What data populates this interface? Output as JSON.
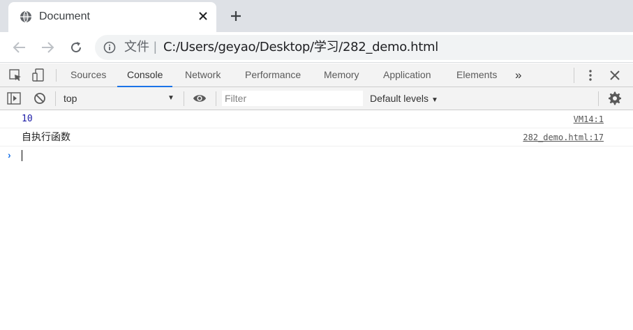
{
  "browser": {
    "tab_title": "Document",
    "new_tab_symbol": "+",
    "close_symbol": "✕",
    "address": {
      "scheme_label": "文件",
      "separator": "|",
      "url": "C:/Users/geyao/Desktop/学习/282_demo.html"
    }
  },
  "devtools": {
    "tabs": [
      {
        "label": "Sources"
      },
      {
        "label": "Console",
        "active": true
      },
      {
        "label": "Network"
      },
      {
        "label": "Performance"
      },
      {
        "label": "Memory"
      },
      {
        "label": "Application"
      },
      {
        "label": "Elements"
      }
    ],
    "more_tabs_symbol": "»",
    "accent_color": "#1a73e8"
  },
  "console_toolbar": {
    "context": "top",
    "filter_placeholder": "Filter",
    "levels": "Default levels"
  },
  "console": {
    "messages": [
      {
        "text": "10",
        "source": "VM14:1",
        "kind": "number"
      },
      {
        "text": "自执行函数",
        "source": "282_demo.html:17",
        "kind": "string"
      }
    ],
    "prompt_symbol": "›"
  }
}
